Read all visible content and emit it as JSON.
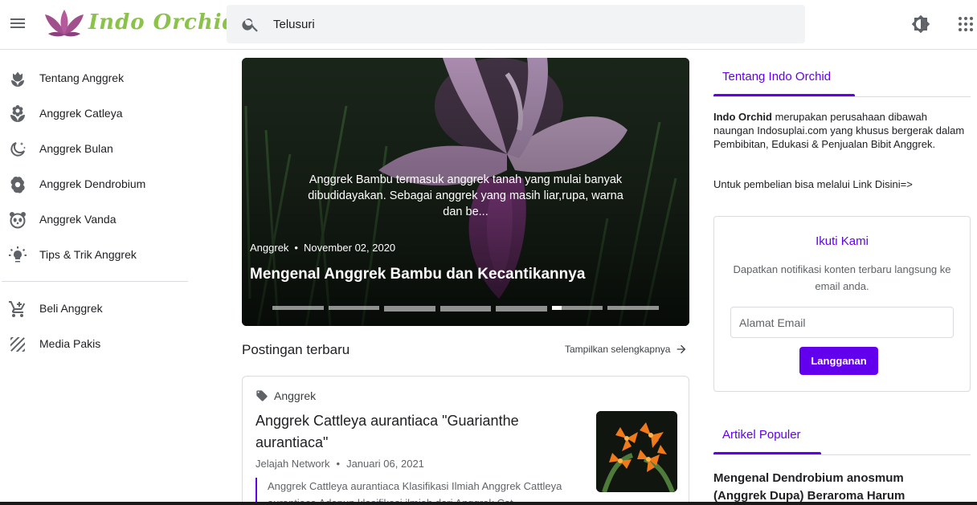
{
  "header": {
    "logo_text": "Indo Orchid",
    "search_placeholder": "Telusuri",
    "icons": [
      "menu-icon",
      "search-icon",
      "brightness-icon",
      "apps-grid-icon"
    ]
  },
  "sidebar": {
    "items": [
      {
        "label": "Tentang Anggrek",
        "icon": "tulip-icon"
      },
      {
        "label": "Anggrek Catleya",
        "icon": "lotus-icon"
      },
      {
        "label": "Anggrek Bulan",
        "icon": "moon-stars-icon"
      },
      {
        "label": "Anggrek Dendrobium",
        "icon": "flower-icon"
      },
      {
        "label": "Anggrek Vanda",
        "icon": "panda-icon"
      },
      {
        "label": "Tips & Trik Anggrek",
        "icon": "lightbulb-icon"
      }
    ],
    "secondary": [
      {
        "label": "Beli Anggrek",
        "icon": "cart-icon"
      },
      {
        "label": "Media Pakis",
        "icon": "texture-icon"
      }
    ]
  },
  "slider": {
    "excerpt": "Anggrek Bambu termasuk anggrek tanah yang mulai banyak dibudidayakan. Sebagai anggrek yang masih liar,rupa, warna dan be...",
    "label": "Anggrek",
    "separator": "•",
    "date": "November 02, 2020",
    "title": "Mengenal Anggrek Bambu dan Kecantikannya",
    "slide_count": 7,
    "active_index": 5
  },
  "recent": {
    "heading": "Postingan terbaru",
    "more_label": "Tampilkan selengkapnya",
    "post": {
      "label": "Anggrek",
      "title": "Anggrek Cattleya aurantiaca \"Guarianthe aurantiaca\"",
      "author": "Jelajah Network",
      "separator": "•",
      "date": "Januari 06, 2021",
      "snippet": "Anggrek Cattleya aurantiaca Klasifikasi Ilmiah Anggrek Cattleya aurantiaca Adapun klasifikasi ilmiah dari Anggrek Cat..."
    }
  },
  "right": {
    "about_tab": "Tentang Indo Orchid",
    "about_brand": "Indo Orchid",
    "about_text": " merupakan perusahaan dibawah naungan Indosuplai.com yang khusus bergerak dalam Pembibitan, Edukasi & Penjualan Bibit Anggrek.",
    "about_link": "Untuk pembelian bisa melalui Link Disini=>",
    "follow": {
      "title": "Ikuti Kami",
      "description": "Dapatkan notifikasi konten terbaru langsung ke email anda.",
      "email_placeholder": "Alamat Email",
      "button": "Langganan"
    },
    "popular_tab": "Artikel Populer",
    "popular_title": "Mengenal Dendrobium anosmum (Anggrek Dupa) Beraroma Harum"
  },
  "colors": {
    "accent": "#6200ee",
    "logo_green": "#8bc34a",
    "logo_purple": "#a0508c"
  }
}
